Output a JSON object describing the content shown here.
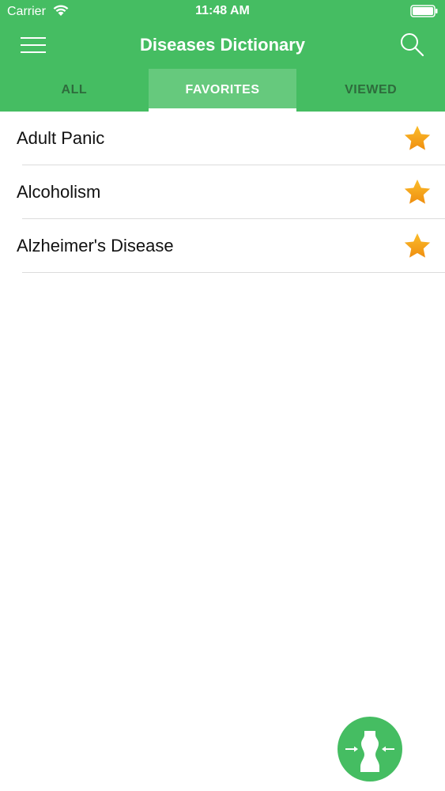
{
  "status_bar": {
    "carrier": "Carrier",
    "time": "11:48 AM"
  },
  "nav": {
    "title": "Diseases Dictionary"
  },
  "tabs": [
    {
      "label": "ALL",
      "active": false
    },
    {
      "label": "FAVORITES",
      "active": true
    },
    {
      "label": "VIEWED",
      "active": false
    }
  ],
  "favorites": [
    {
      "label": "Adult Panic"
    },
    {
      "label": "Alcoholism"
    },
    {
      "label": "Alzheimer's Disease"
    }
  ],
  "icons": {
    "menu": "hamburger-menu-icon",
    "search": "search-icon",
    "favorite": "star-icon",
    "fab": "body-fit-icon"
  },
  "colors": {
    "accent": "#45bd62",
    "active_tab": "#66c97d",
    "star": "#f4a516"
  }
}
